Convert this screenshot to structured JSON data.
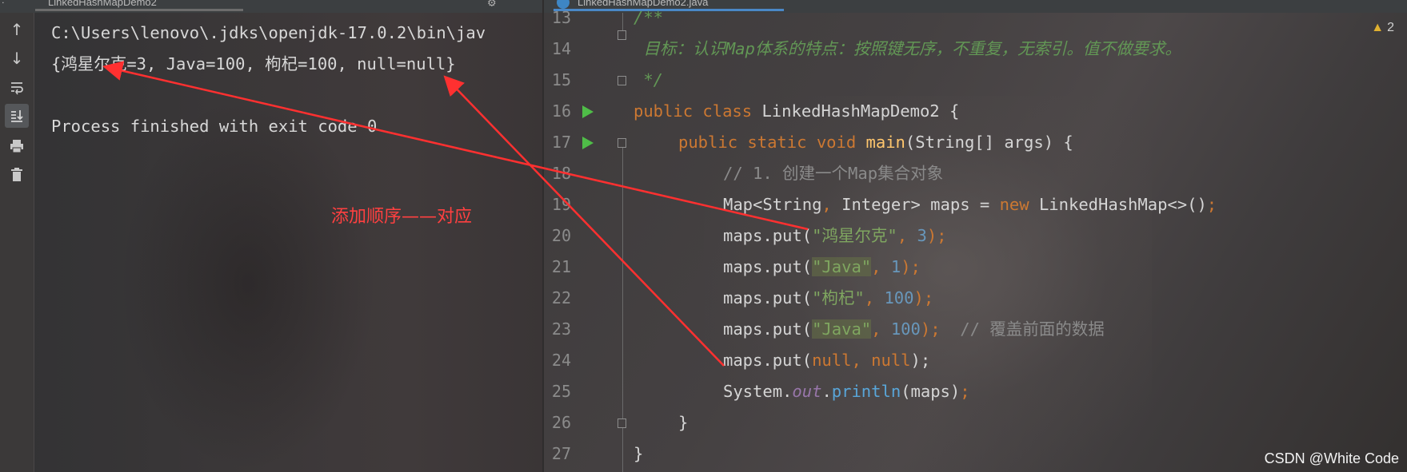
{
  "run_panel": {
    "tab_title": "LinkedHashMapDemo2",
    "console_lines": [
      "C:\\Users\\lenovo\\.jdks\\openjdk-17.0.2\\bin\\jav",
      "{鸿星尔克=3, Java=100, 枸杞=100, null=null}",
      "",
      "Process finished with exit code 0"
    ],
    "toolbar_icons": [
      "arrow-up-icon",
      "arrow-down-icon",
      "soft-wrap-icon",
      "scroll-to-end-icon",
      "print-icon",
      "trash-icon"
    ]
  },
  "annotation": {
    "text": "添加顺序——对应",
    "color": "#ff4040"
  },
  "editor": {
    "tab_title": "LinkedHashMapDemo2.java",
    "warning_count": "2",
    "line_numbers": [
      "13",
      "14",
      "15",
      "16",
      "17",
      "18",
      "19",
      "20",
      "21",
      "22",
      "23",
      "24",
      "25",
      "26",
      "27"
    ],
    "code": {
      "l13": "/**",
      "l14": " 目标：认识Map体系的特点：按照键无序，不重复，无索引。值不做要求。",
      "l15": " */",
      "l16_kw1": "public",
      "l16_kw2": "class",
      "l16_name": " LinkedHashMapDemo2 {",
      "l17_kw1": "public",
      "l17_kw2": "static",
      "l17_kw3": "void",
      "l17_fn": "main",
      "l17_rest": "(String[] args) {",
      "l18": "// 1. 创建一个Map集合对象",
      "l19_a": "Map<String",
      "l19_b": ",",
      "l19_c": " Integer> maps = ",
      "l19_kw": "new",
      "l19_d": " LinkedHashMap<>()",
      "l19_e": ";",
      "l20_a": "maps.put(",
      "l20_str": "\"鸿星尔克\"",
      "l20_comma": ", ",
      "l20_num": "3",
      "l20_end": ");",
      "l21_a": "maps.put(",
      "l21_str": "\"Java\"",
      "l21_comma": ", ",
      "l21_num": "1",
      "l21_end": ");",
      "l22_a": "maps.put(",
      "l22_str": "\"枸杞\"",
      "l22_comma": ", ",
      "l22_num": "100",
      "l22_end": ");",
      "l23_a": "maps.put(",
      "l23_str": "\"Java\"",
      "l23_comma": ", ",
      "l23_num": "100",
      "l23_end": ");",
      "l23_cmt": "  // 覆盖前面的数据",
      "l24_a": "maps.put(",
      "l24_kw1": "null",
      "l24_comma": ", ",
      "l24_kw2": "null",
      "l24_end": ");",
      "l25_a": "System.",
      "l25_field": "out",
      "l25_dot": ".",
      "l25_method": "println",
      "l25_end": "(maps)",
      "l25_semi": ";",
      "l26": "}",
      "l27": "}"
    }
  },
  "watermark": "CSDN @White Code"
}
